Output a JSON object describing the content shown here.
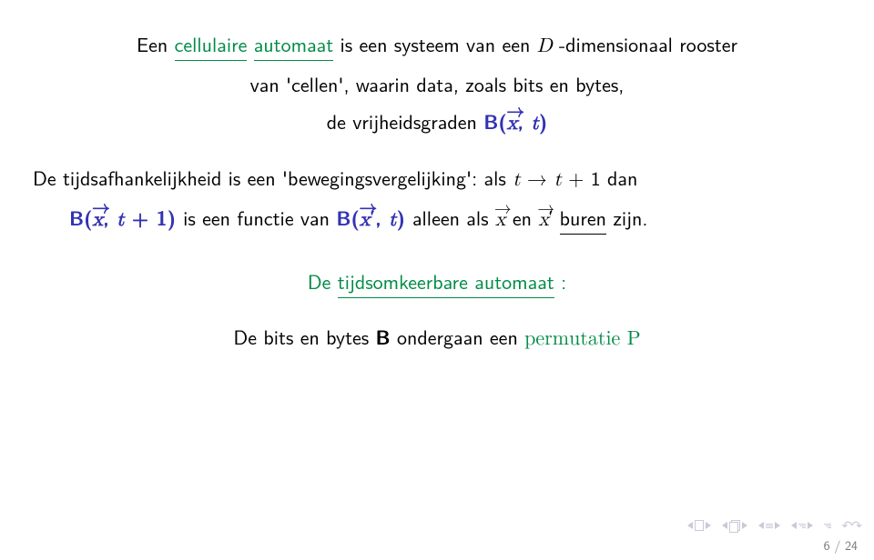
{
  "p1": {
    "a": "Een ",
    "cell": "cellulaire",
    "b": " ",
    "auto": "automaat",
    "c": " is een systeem van een ",
    "D": "D",
    "d": "-dimensionaal rooster"
  },
  "p1b": {
    "a": "van 'cellen', waarin data, zoals bits en bytes,"
  },
  "p1c": {
    "a": "de vrijheidsgraden ",
    "Bopen": "B(",
    "x": "x",
    "comma": ", ",
    "t": "t",
    "close": ")"
  },
  "p2": {
    "a": "De tijdsafhankelijkheid is een 'bewegingsvergelijking': als  ",
    "t1": "t",
    "arrow": " → ",
    "t2": "t",
    "plus1": " + 1",
    "dan": "  dan"
  },
  "p3": {
    "Bopen": "B(",
    "x": "x",
    "comma": ", ",
    "t": "t",
    "plus1": " + 1)",
    "mid": " is een functie van ",
    "Bopen2": "B(",
    "x2": "x",
    "comma2": ", ",
    "t2": "t",
    "close2": ")",
    "mid2": " alleen als ",
    "x3": "x",
    "en": " en ",
    "x4": "x",
    "sp": " ",
    "buren": "buren",
    "zijn": " zijn."
  },
  "p4": {
    "a": "De ",
    "link": "tijdsomkeerbare automaat",
    "b": ":"
  },
  "p5": {
    "a": "De bits en bytes ",
    "B": "B",
    "b": " ondergaan een ",
    "perm": "permutatie P"
  },
  "footer": {
    "page": "6 / 24"
  }
}
